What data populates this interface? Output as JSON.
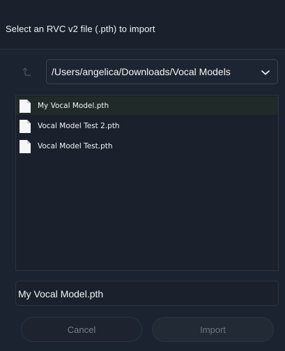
{
  "dialog": {
    "title": "Select an RVC v2 file (.pth) to import"
  },
  "navigation": {
    "up_icon": "arrow-up-icon",
    "current_path": "/Users/angelica/Downloads/Vocal Models",
    "dropdown_icon": "chevron-down-icon"
  },
  "files": [
    {
      "name": "My Vocal Model.pth",
      "selected": true,
      "icon": "file-icon"
    },
    {
      "name": "Vocal Model Test 2.pth",
      "selected": false,
      "icon": "file-icon"
    },
    {
      "name": "Vocal Model Test.pth",
      "selected": false,
      "icon": "file-icon"
    }
  ],
  "filename_input": {
    "value": "My Vocal Model.pth"
  },
  "actions": {
    "cancel_label": "Cancel",
    "import_label": "Import"
  },
  "colors": {
    "background": "#1c2330",
    "selected_row": "#202a28",
    "text": "#f4f5f8",
    "disabled_text": "#7a818d"
  }
}
